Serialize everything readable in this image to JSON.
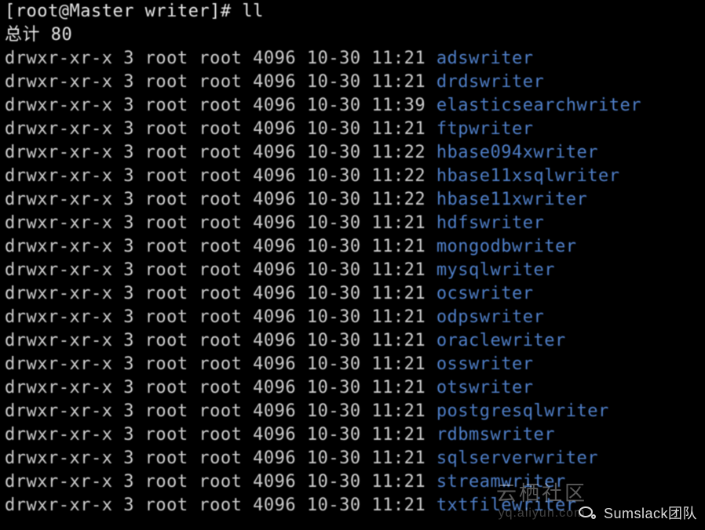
{
  "prompt_line": "[root@Master writer]# ll",
  "total_line": "总计 80",
  "rows": [
    {
      "perm": "drwxr-xr-x",
      "n": "3",
      "u": "root",
      "g": "root",
      "size": "4096",
      "date": "10-30",
      "time": "11:21",
      "name": "adswriter"
    },
    {
      "perm": "drwxr-xr-x",
      "n": "3",
      "u": "root",
      "g": "root",
      "size": "4096",
      "date": "10-30",
      "time": "11:21",
      "name": "drdswriter"
    },
    {
      "perm": "drwxr-xr-x",
      "n": "3",
      "u": "root",
      "g": "root",
      "size": "4096",
      "date": "10-30",
      "time": "11:39",
      "name": "elasticsearchwriter"
    },
    {
      "perm": "drwxr-xr-x",
      "n": "3",
      "u": "root",
      "g": "root",
      "size": "4096",
      "date": "10-30",
      "time": "11:21",
      "name": "ftpwriter"
    },
    {
      "perm": "drwxr-xr-x",
      "n": "3",
      "u": "root",
      "g": "root",
      "size": "4096",
      "date": "10-30",
      "time": "11:22",
      "name": "hbase094xwriter"
    },
    {
      "perm": "drwxr-xr-x",
      "n": "3",
      "u": "root",
      "g": "root",
      "size": "4096",
      "date": "10-30",
      "time": "11:22",
      "name": "hbase11xsqlwriter"
    },
    {
      "perm": "drwxr-xr-x",
      "n": "3",
      "u": "root",
      "g": "root",
      "size": "4096",
      "date": "10-30",
      "time": "11:22",
      "name": "hbase11xwriter"
    },
    {
      "perm": "drwxr-xr-x",
      "n": "3",
      "u": "root",
      "g": "root",
      "size": "4096",
      "date": "10-30",
      "time": "11:21",
      "name": "hdfswriter"
    },
    {
      "perm": "drwxr-xr-x",
      "n": "3",
      "u": "root",
      "g": "root",
      "size": "4096",
      "date": "10-30",
      "time": "11:21",
      "name": "mongodbwriter"
    },
    {
      "perm": "drwxr-xr-x",
      "n": "3",
      "u": "root",
      "g": "root",
      "size": "4096",
      "date": "10-30",
      "time": "11:21",
      "name": "mysqlwriter"
    },
    {
      "perm": "drwxr-xr-x",
      "n": "3",
      "u": "root",
      "g": "root",
      "size": "4096",
      "date": "10-30",
      "time": "11:21",
      "name": "ocswriter"
    },
    {
      "perm": "drwxr-xr-x",
      "n": "3",
      "u": "root",
      "g": "root",
      "size": "4096",
      "date": "10-30",
      "time": "11:21",
      "name": "odpswriter"
    },
    {
      "perm": "drwxr-xr-x",
      "n": "3",
      "u": "root",
      "g": "root",
      "size": "4096",
      "date": "10-30",
      "time": "11:21",
      "name": "oraclewriter"
    },
    {
      "perm": "drwxr-xr-x",
      "n": "3",
      "u": "root",
      "g": "root",
      "size": "4096",
      "date": "10-30",
      "time": "11:21",
      "name": "osswriter"
    },
    {
      "perm": "drwxr-xr-x",
      "n": "3",
      "u": "root",
      "g": "root",
      "size": "4096",
      "date": "10-30",
      "time": "11:21",
      "name": "otswriter"
    },
    {
      "perm": "drwxr-xr-x",
      "n": "3",
      "u": "root",
      "g": "root",
      "size": "4096",
      "date": "10-30",
      "time": "11:21",
      "name": "postgresqlwriter"
    },
    {
      "perm": "drwxr-xr-x",
      "n": "3",
      "u": "root",
      "g": "root",
      "size": "4096",
      "date": "10-30",
      "time": "11:21",
      "name": "rdbmswriter"
    },
    {
      "perm": "drwxr-xr-x",
      "n": "3",
      "u": "root",
      "g": "root",
      "size": "4096",
      "date": "10-30",
      "time": "11:21",
      "name": "sqlserverwriter"
    },
    {
      "perm": "drwxr-xr-x",
      "n": "3",
      "u": "root",
      "g": "root",
      "size": "4096",
      "date": "10-30",
      "time": "11:21",
      "name": "streamwriter"
    },
    {
      "perm": "drwxr-xr-x",
      "n": "3",
      "u": "root",
      "g": "root",
      "size": "4096",
      "date": "10-30",
      "time": "11:21",
      "name": "txtfilewriter"
    }
  ],
  "watermark": {
    "team": "Sumslack团队",
    "aliyun_main": "云栖社区",
    "aliyun_sub": "yq.aliyun.com"
  }
}
